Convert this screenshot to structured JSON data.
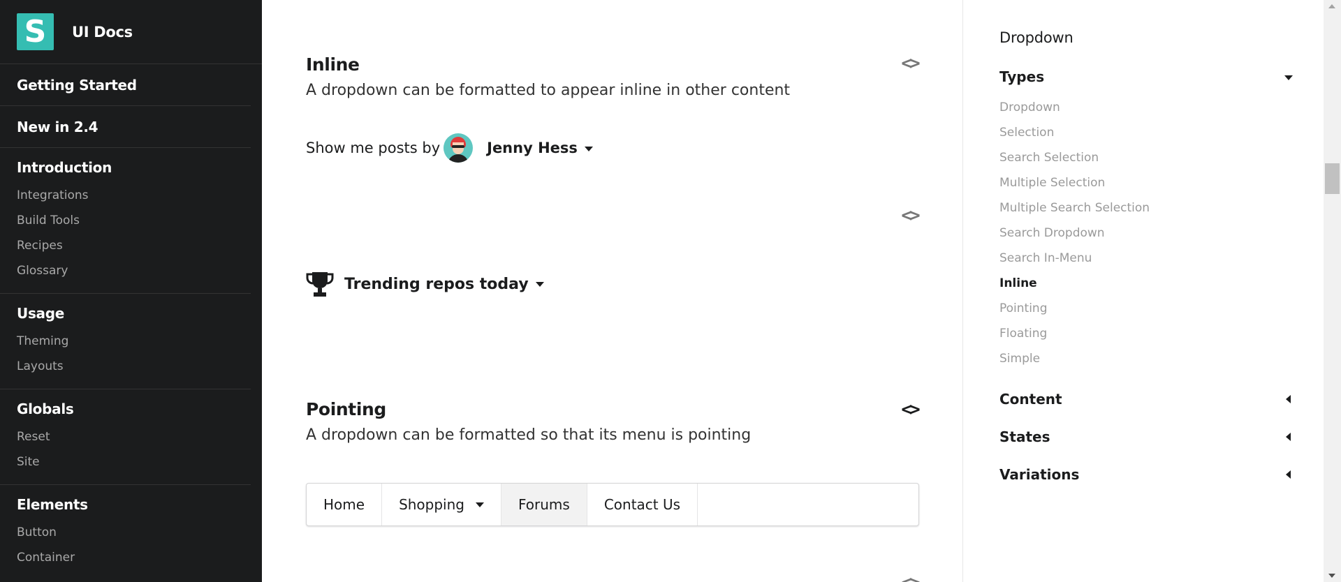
{
  "sidebar": {
    "brand": {
      "logo_letter": "S",
      "name": "UI Docs"
    },
    "sections": [
      {
        "heading": "Getting Started",
        "items": []
      },
      {
        "heading": "New in 2.4",
        "items": []
      },
      {
        "heading": "Introduction",
        "items": [
          "Integrations",
          "Build Tools",
          "Recipes",
          "Glossary"
        ]
      },
      {
        "heading": "Usage",
        "items": [
          "Theming",
          "Layouts"
        ]
      },
      {
        "heading": "Globals",
        "items": [
          "Reset",
          "Site"
        ]
      },
      {
        "heading": "Elements",
        "items": [
          "Button",
          "Container"
        ]
      }
    ]
  },
  "main": {
    "inline": {
      "title": "Inline",
      "description": "A dropdown can be formatted to appear inline in other content",
      "example_prefix": "Show me posts by",
      "example_user": "Jenny Hess"
    },
    "trending": {
      "label": "Trending repos today"
    },
    "pointing": {
      "title": "Pointing",
      "description": "A dropdown can be formatted so that its menu is pointing",
      "menu": [
        "Home",
        "Shopping",
        "Forums",
        "Contact Us"
      ]
    },
    "code_toggle_glyph": "<>"
  },
  "toc": {
    "title": "Dropdown",
    "types_heading": "Types",
    "types": [
      "Dropdown",
      "Selection",
      "Search Selection",
      "Multiple Selection",
      "Multiple Search Selection",
      "Search Dropdown",
      "Search In-Menu",
      "Inline",
      "Pointing",
      "Floating",
      "Simple"
    ],
    "current": "Inline",
    "other_headings": [
      "Content",
      "States",
      "Variations"
    ]
  },
  "colors": {
    "sidebar_bg": "#1b1c1d",
    "logo_bg": "#35bdb2",
    "muted_text": "#9a9a9a"
  }
}
